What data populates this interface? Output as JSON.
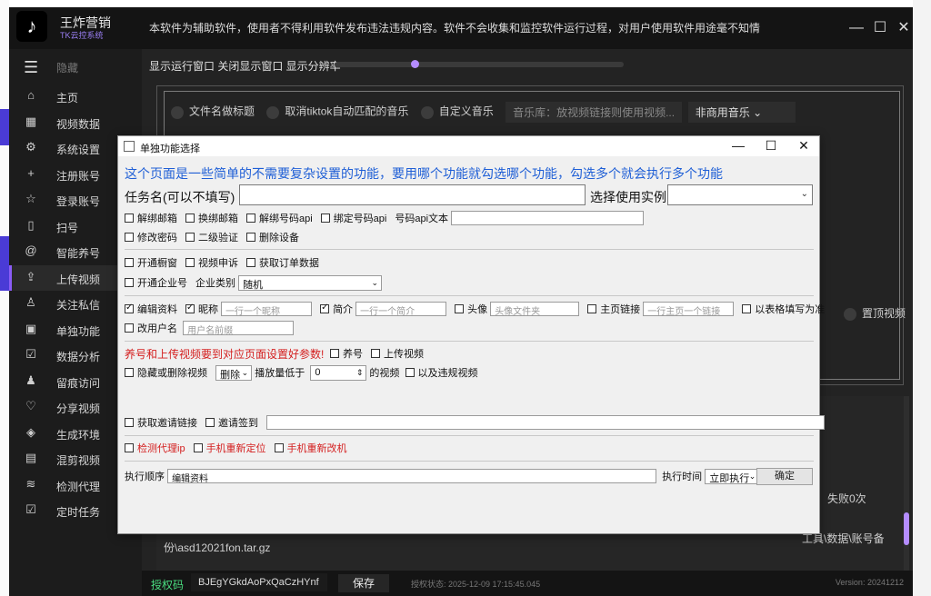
{
  "app": {
    "brand_name": "王炸营销",
    "brand_sub": "TK云控系统",
    "notice": "本软件为辅助软件，使用者不得利用软件发布违法违规内容。软件不会收集和监控软件运行过程，对用户使用软件用途毫不知情",
    "hide_label": "隐藏",
    "top_controls": "显示运行窗口  关闭显示窗口  显示分辨率",
    "window_buttons": {
      "min": "—",
      "max": "☐",
      "close": "✕"
    }
  },
  "sidebar": {
    "items": [
      {
        "label": "主页",
        "icon": "home-icon",
        "glyph": "⌂"
      },
      {
        "label": "视频数据",
        "icon": "film-icon",
        "glyph": "▦"
      },
      {
        "label": "系统设置",
        "icon": "gear-icon",
        "glyph": "⚙"
      },
      {
        "label": "注册账号",
        "icon": "plus-icon",
        "glyph": "+"
      },
      {
        "label": "登录账号",
        "icon": "star-icon",
        "glyph": "☆"
      },
      {
        "label": "扫号",
        "icon": "phone-icon",
        "glyph": "▯"
      },
      {
        "label": "智能养号",
        "icon": "at-icon",
        "glyph": "@"
      },
      {
        "label": "上传视频",
        "icon": "cloud-upload-icon",
        "glyph": "⇪"
      },
      {
        "label": "关注私信",
        "icon": "user-add-icon",
        "glyph": "♙"
      },
      {
        "label": "单独功能",
        "icon": "4k-icon",
        "glyph": "▣"
      },
      {
        "label": "数据分析",
        "icon": "calendar-check-icon",
        "glyph": "☑"
      },
      {
        "label": "留痕访问",
        "icon": "users-icon",
        "glyph": "♟"
      },
      {
        "label": "分享视频",
        "icon": "heart-icon",
        "glyph": "♡"
      },
      {
        "label": "生成环境",
        "icon": "layers-icon",
        "glyph": "◈"
      },
      {
        "label": "混剪视频",
        "icon": "film-strip-icon",
        "glyph": "▤"
      },
      {
        "label": "检测代理",
        "icon": "rss-icon",
        "glyph": "≋"
      },
      {
        "label": "定时任务",
        "icon": "checklist-icon",
        "glyph": "☑"
      }
    ],
    "active_index": 7
  },
  "upload_panel": {
    "options_row": [
      "文件名做标题",
      "取消tiktok自动匹配的音乐",
      "自定义音乐"
    ],
    "music_lib_placeholder": "音乐库：放视频链接则使用视频...",
    "music_select": "非商用音乐",
    "right_option": "置顶视频",
    "log_tail": "份\\asd12021fon.tar.gz",
    "log_right_1": "失败0次",
    "log_right_2": "工具\\数据\\账号备"
  },
  "bottom": {
    "auth_label": "授权码",
    "auth_code": "BJEgYGkdAoPxQaCzHYnf",
    "save": "保存",
    "status": "授权状态: 2025-12-09 17:15:45.045",
    "version": "Version: 20241212"
  },
  "dialog": {
    "title": "单独功能选择",
    "headline": "这个页面是一些简单的不需要复杂设置的功能，要用哪个功能就勾选哪个功能，勾选多个就会执行多个功能",
    "task_name_label": "任务名(可以不填写)",
    "instance_label": "选择使用实例",
    "row1": {
      "unbind_email": "解绑邮箱",
      "change_email": "换绑邮箱",
      "unbind_phone_api": "解绑号码api",
      "bind_phone_api": "绑定号码api",
      "phone_api_text": "号码api文本"
    },
    "row2": {
      "change_password": "修改密码",
      "two_step": "二级验证",
      "delete_device": "删除设备"
    },
    "row3": {
      "open_showcase": "开通橱窗",
      "video_appeal": "视频申诉",
      "get_order": "获取订单数据"
    },
    "row4": {
      "open_business": "开通企业号",
      "business_type_label": "企业类别",
      "business_type": "随机"
    },
    "row5": {
      "edit_profile": "编辑资料",
      "nickname": "昵称",
      "nickname_ph": "一行一个昵称",
      "bio": "简介",
      "bio_ph": "一行一个简介",
      "avatar": "头像",
      "avatar_ph": "头像文件夹",
      "homepage": "主页链接",
      "homepage_ph": "一行主页一个链接",
      "table_fill": "以表格填写为准"
    },
    "row6": {
      "change_username": "改用户名",
      "username_ph": "用户名前缀"
    },
    "warning": "养号和上传视频要到对应页面设置好参数!",
    "row7": {
      "raise": "养号",
      "upload": "上传视频"
    },
    "row8": {
      "hide_delete": "隐藏或删除视频",
      "action": "删除",
      "plays_lower": "播放量低于",
      "plays_value": "0",
      "videos": "的视频",
      "violations": "以及违规视频"
    },
    "row9": {
      "get_invite": "获取邀请链接",
      "invite_signin": "邀请签到"
    },
    "row10": {
      "check_proxy": "检测代理ip",
      "relocate_phone": "手机重新定位",
      "remodel_phone": "手机重新改机"
    },
    "exec_order_label": "执行顺序",
    "exec_order_value": "编辑资料",
    "exec_time_label": "执行时间",
    "exec_time_value": "立即执行",
    "confirm": "确定"
  },
  "colors": {
    "accent": "#8b5cf6",
    "headline_blue": "#1f5fd6",
    "warning_red": "#d42020",
    "auth_green": "#4ade80"
  }
}
